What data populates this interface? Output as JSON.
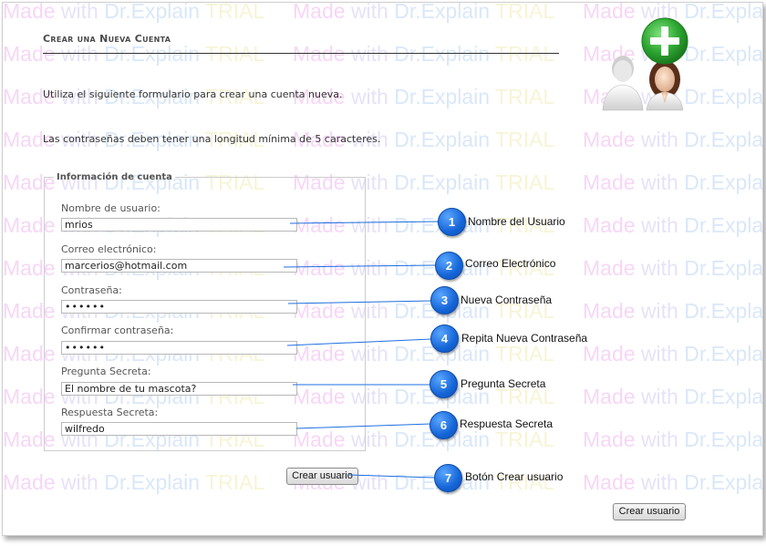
{
  "watermark": {
    "made": "Made",
    "with": "with",
    "dr": "Dr.Explain",
    "trial": "TRIAL"
  },
  "page": {
    "title": "Crear una Nueva Cuenta",
    "intro": "Utiliza el siguiente formulario para crear una cuenta nueva.",
    "password_note": "Las contraseñas deben tener una longitud mínima de 5 caracteres."
  },
  "header_icon": "add-user-icon",
  "account": {
    "legend": "Información de cuenta",
    "fields": [
      {
        "label": "Nombre de usuario:",
        "value": "mrios"
      },
      {
        "label": "Correo electrónico:",
        "value": "marcerios@hotmail.com"
      },
      {
        "label": "Contraseña:",
        "value": "••••••"
      },
      {
        "label": "Confirmar contraseña:",
        "value": "••••••"
      },
      {
        "label": "Pregunta Secreta:",
        "value": "El nombre de tu mascota?"
      },
      {
        "label": "Respuesta Secreta:",
        "value": "wilfredo"
      }
    ]
  },
  "buttons": {
    "create_user": "Crear usuario",
    "create_user_bottom": "Crear usuario"
  },
  "callouts": [
    {
      "number": "1",
      "label": "Nombre del Usuario"
    },
    {
      "number": "2",
      "label": "Correo Electrónico"
    },
    {
      "number": "3",
      "label": "Nueva Contraseña"
    },
    {
      "number": "4",
      "label": "Repita Nueva Contraseña"
    },
    {
      "number": "5",
      "label": "Pregunta Secreta"
    },
    {
      "number": "6",
      "label": "Respuesta Secreta"
    },
    {
      "number": "7",
      "label": "Botón Crear usuario"
    }
  ],
  "colors": {
    "callout_blue": "#1565d8",
    "green_plus": "#2fa833"
  }
}
